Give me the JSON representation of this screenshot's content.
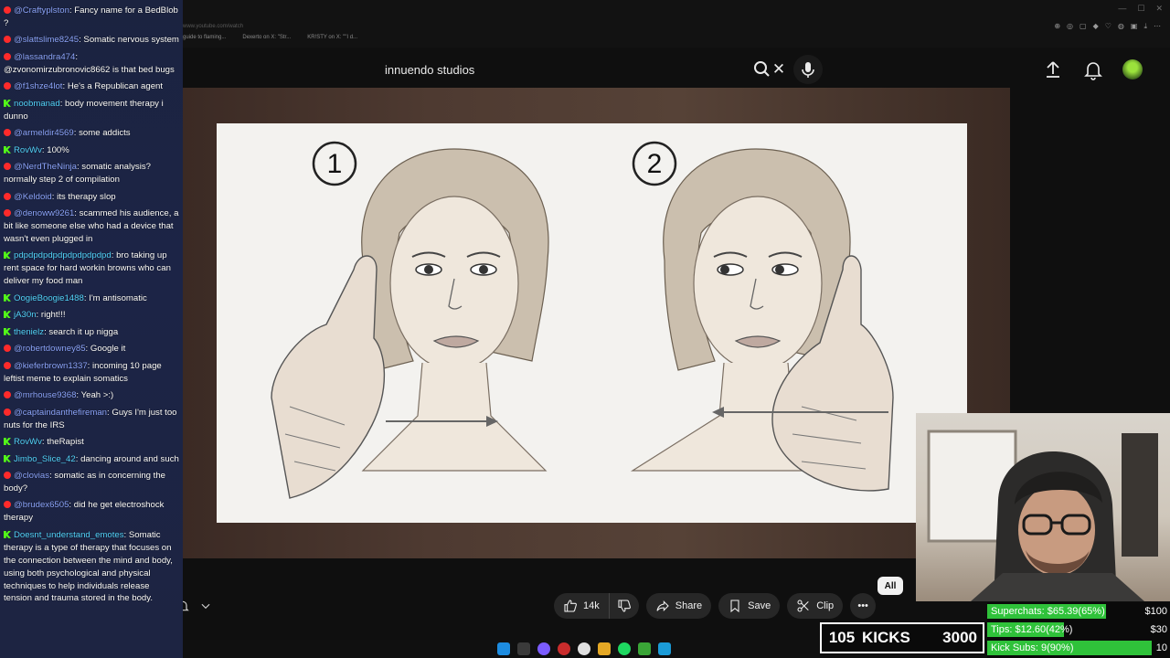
{
  "browser": {
    "tabs": [
      "guide to flaming...",
      "Dexerto on X: \"Str...",
      "KR!STY on X: \"\"I d..."
    ],
    "url_hint": "www.youtube.com/watch",
    "win_controls": [
      "—",
      "☐",
      "✕"
    ]
  },
  "header": {
    "search_value": "innuendo studios",
    "clear_icon": "✕"
  },
  "video": {
    "panel_1_number": "1",
    "panel_2_number": "2"
  },
  "actions": {
    "likes": "14k",
    "share": "Share",
    "save": "Save",
    "clip": "Clip",
    "more": "•••",
    "chip_all": "All"
  },
  "chat": [
    {
      "platform": "yt",
      "user": "@Craftyplston",
      "text": "Fancy name for a BedBlob ?"
    },
    {
      "platform": "yt",
      "user": "@slattslime8245",
      "text": "Somatic nervous system"
    },
    {
      "platform": "yt",
      "user": "@lassandra474",
      "text": "@zvonomirzubronovic8662 is that bed bugs"
    },
    {
      "platform": "yt",
      "user": "@f1shze4lot",
      "text": "He's a Republican agent"
    },
    {
      "platform": "kick",
      "user": "noobmanad",
      "text": "body movement therapy i dunno"
    },
    {
      "platform": "yt",
      "user": "@armeldir4569",
      "text": "some addicts"
    },
    {
      "platform": "kick",
      "user": "RovWv",
      "text": "100%"
    },
    {
      "platform": "yt",
      "user": "@NerdTheNinja",
      "text": "somatic analysis? normally step 2 of compilation"
    },
    {
      "platform": "yt",
      "user": "@Keldoid",
      "text": "its therapy slop"
    },
    {
      "platform": "yt",
      "user": "@denoww9261",
      "text": "scammed his audience, a bit like someone else who had a device that wasn't even plugged in"
    },
    {
      "platform": "kick",
      "user": "pdpdpdpdpdpdpdpdpdpd",
      "text": "bro taking up rent space for hard workin browns who can deliver my food man"
    },
    {
      "platform": "kick",
      "user": "OogieBoogie1488",
      "text": "I'm antisomatic"
    },
    {
      "platform": "kick",
      "user": "jA30n",
      "text": "right!!!"
    },
    {
      "platform": "kick",
      "user": "thenielz",
      "text": "search it up nigga"
    },
    {
      "platform": "yt",
      "user": "@robertdowney85",
      "text": "Google it"
    },
    {
      "platform": "yt",
      "user": "@kieferbrown1337",
      "text": "incoming 10 page leftist meme to explain somatics"
    },
    {
      "platform": "yt",
      "user": "@mrhouse9368",
      "text": "Yeah >:)"
    },
    {
      "platform": "yt",
      "user": "@captaindanthefireman",
      "text": "Guys I'm just too nuts for the IRS"
    },
    {
      "platform": "kick",
      "user": "RovWv",
      "text": "theRapist"
    },
    {
      "platform": "kick",
      "user": "Jimbo_Slice_42",
      "text": "dancing around and such"
    },
    {
      "platform": "yt",
      "user": "@clovias",
      "text": "somatic as in concerning the body?"
    },
    {
      "platform": "yt",
      "user": "@brudex6505",
      "text": "did he get electroshock therapy"
    },
    {
      "platform": "kick",
      "user": "Doesnt_understand_emotes",
      "text": "Somatic therapy is a type of therapy that focuses on the connection between the mind and body, using both psychological and physical techniques to help individuals release tension and trauma stored in the body."
    }
  ],
  "goals": {
    "superchats": {
      "label": "Superchats: $65.39(65%)",
      "max": "$100",
      "progress": 0.65
    },
    "tips": {
      "label": "Tips: $12.60(42%)",
      "max": "$30",
      "progress": 0.42
    },
    "kick_subs": {
      "label": "Kick Subs: 9(90%)",
      "max": "10",
      "progress": 0.9
    }
  },
  "kicks": {
    "count": "105",
    "label": "KICKS",
    "target": "3000"
  },
  "colors": {
    "youtube_red": "#ff2a2a",
    "kick_green": "#53fc18",
    "goal_green": "#2fc23a",
    "chat_bg": "#1c2446"
  }
}
